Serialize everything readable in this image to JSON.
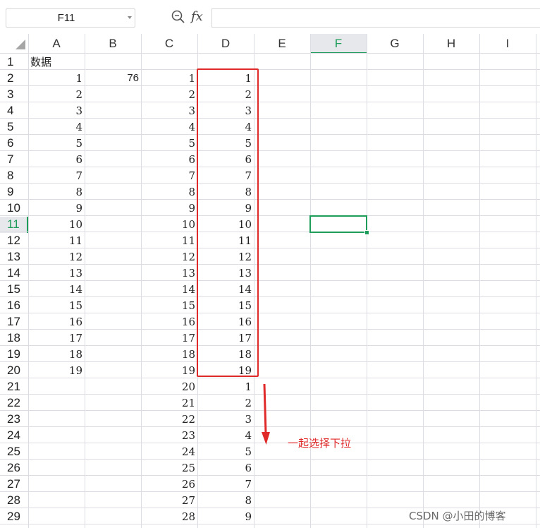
{
  "name_box": {
    "value": "F11"
  },
  "formula_bar": {
    "fx_label": "fx",
    "value": ""
  },
  "columns": [
    "A",
    "B",
    "C",
    "D",
    "E",
    "F",
    "G",
    "H",
    "I"
  ],
  "active_column": "F",
  "active_row": "11",
  "rows": [
    {
      "n": "1",
      "A": "数据",
      "B": "",
      "C": "",
      "D": ""
    },
    {
      "n": "2",
      "A": "1",
      "B": "76",
      "C": "1",
      "D": "1"
    },
    {
      "n": "3",
      "A": "2",
      "B": "",
      "C": "2",
      "D": "2"
    },
    {
      "n": "4",
      "A": "3",
      "B": "",
      "C": "3",
      "D": "3"
    },
    {
      "n": "5",
      "A": "4",
      "B": "",
      "C": "4",
      "D": "4"
    },
    {
      "n": "6",
      "A": "5",
      "B": "",
      "C": "5",
      "D": "5"
    },
    {
      "n": "7",
      "A": "6",
      "B": "",
      "C": "6",
      "D": "6"
    },
    {
      "n": "8",
      "A": "7",
      "B": "",
      "C": "7",
      "D": "7"
    },
    {
      "n": "9",
      "A": "8",
      "B": "",
      "C": "8",
      "D": "8"
    },
    {
      "n": "10",
      "A": "9",
      "B": "",
      "C": "9",
      "D": "9"
    },
    {
      "n": "11",
      "A": "10",
      "B": "",
      "C": "10",
      "D": "10"
    },
    {
      "n": "12",
      "A": "11",
      "B": "",
      "C": "11",
      "D": "11"
    },
    {
      "n": "13",
      "A": "12",
      "B": "",
      "C": "12",
      "D": "12"
    },
    {
      "n": "14",
      "A": "13",
      "B": "",
      "C": "13",
      "D": "13"
    },
    {
      "n": "15",
      "A": "14",
      "B": "",
      "C": "14",
      "D": "14"
    },
    {
      "n": "16",
      "A": "15",
      "B": "",
      "C": "15",
      "D": "15"
    },
    {
      "n": "17",
      "A": "16",
      "B": "",
      "C": "16",
      "D": "16"
    },
    {
      "n": "18",
      "A": "17",
      "B": "",
      "C": "17",
      "D": "17"
    },
    {
      "n": "19",
      "A": "18",
      "B": "",
      "C": "18",
      "D": "18"
    },
    {
      "n": "20",
      "A": "19",
      "B": "",
      "C": "19",
      "D": "19"
    },
    {
      "n": "21",
      "A": "",
      "B": "",
      "C": "20",
      "D": "1"
    },
    {
      "n": "22",
      "A": "",
      "B": "",
      "C": "21",
      "D": "2"
    },
    {
      "n": "23",
      "A": "",
      "B": "",
      "C": "22",
      "D": "3"
    },
    {
      "n": "24",
      "A": "",
      "B": "",
      "C": "23",
      "D": "4"
    },
    {
      "n": "25",
      "A": "",
      "B": "",
      "C": "24",
      "D": "5"
    },
    {
      "n": "26",
      "A": "",
      "B": "",
      "C": "25",
      "D": "6"
    },
    {
      "n": "27",
      "A": "",
      "B": "",
      "C": "26",
      "D": "7"
    },
    {
      "n": "28",
      "A": "",
      "B": "",
      "C": "27",
      "D": "8"
    },
    {
      "n": "29",
      "A": "",
      "B": "",
      "C": "28",
      "D": "9"
    }
  ],
  "annotation": {
    "text": "一起选择下拉"
  },
  "watermark": {
    "text": "CSDN @小田的博客"
  },
  "colors": {
    "highlight": "#e02a2a",
    "accent": "#1e9c5a",
    "grid": "#dcdde2"
  }
}
